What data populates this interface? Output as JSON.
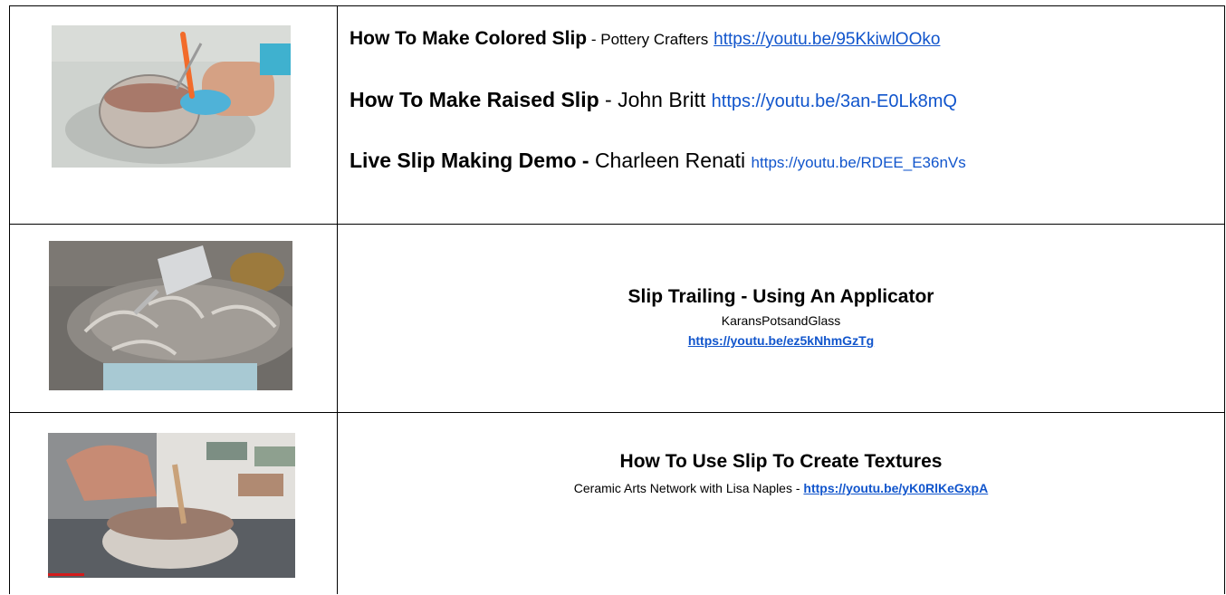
{
  "rows": [
    {
      "thumb_icon": "colored-slip-mixing-thumbnail",
      "entries": [
        {
          "title": "How To Make Colored Slip",
          "sep": " - ",
          "author": "Pottery Crafters",
          "url": "https://youtu.be/95KkiwlOOko"
        },
        {
          "title": "How To Make Raised Slip",
          "sep": " - ",
          "author": "John Britt",
          "url": "https://youtu.be/3an-E0Lk8mQ"
        },
        {
          "title": "Live Slip Making Demo - ",
          "sep": "",
          "author": "Charleen Renati",
          "url": "https://youtu.be/RDEE_E36nVs"
        }
      ]
    },
    {
      "thumb_icon": "slip-trailing-bowl-thumbnail",
      "title": "Slip Trailing - Using An Applicator",
      "author": "KaransPotsandGlass",
      "url": "https://youtu.be/ez5kNhmGzTg"
    },
    {
      "thumb_icon": "slip-texture-mixing-thumbnail",
      "title": "How To Use Slip To Create Textures",
      "author_prefix": "Ceramic Arts Network with Lisa Naples - ",
      "url": "https://youtu.be/yK0RlKeGxpA"
    }
  ],
  "colors": {
    "link": "#1155cc",
    "border": "#000000"
  }
}
